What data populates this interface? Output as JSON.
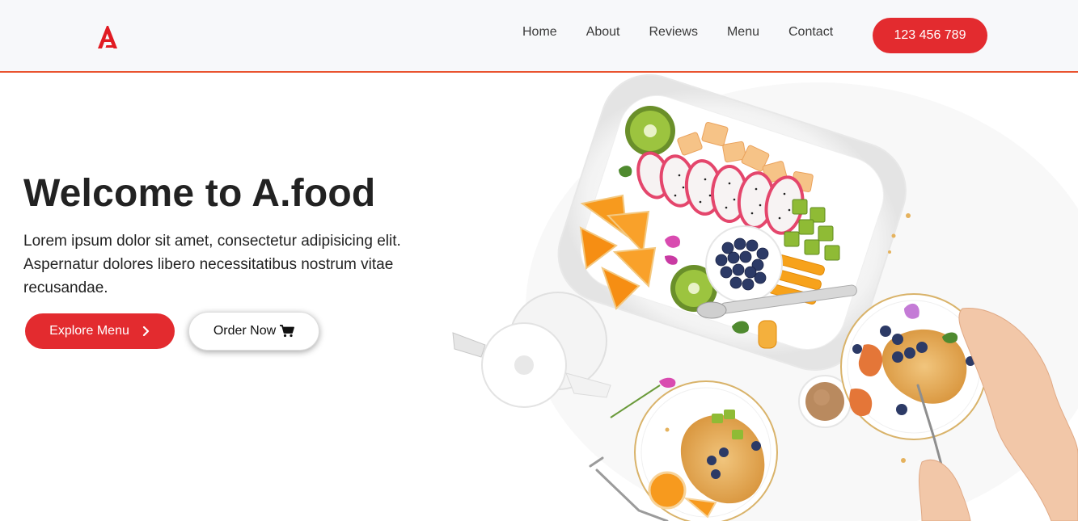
{
  "brand": {
    "logo_letter": "A",
    "color": "#e32b2f"
  },
  "nav": {
    "items": [
      {
        "label": "Home"
      },
      {
        "label": "About"
      },
      {
        "label": "Reviews"
      },
      {
        "label": "Menu"
      },
      {
        "label": "Contact"
      }
    ],
    "phone_label": "123 456 789"
  },
  "hero": {
    "title": "Welcome to A.food",
    "description": "Lorem ipsum dolor sit amet, consectetur adipisicing elit. Aspernatur dolores libero necessitatibus nostrum vitae recusandae.",
    "explore_label": "Explore Menu",
    "order_label": "Order Now",
    "explore_icon": "chevron-right-icon",
    "order_icon": "cart-icon"
  },
  "colors": {
    "accent": "#e32b2f",
    "header_border": "#e9532f",
    "header_bg": "#f7f8fa"
  }
}
